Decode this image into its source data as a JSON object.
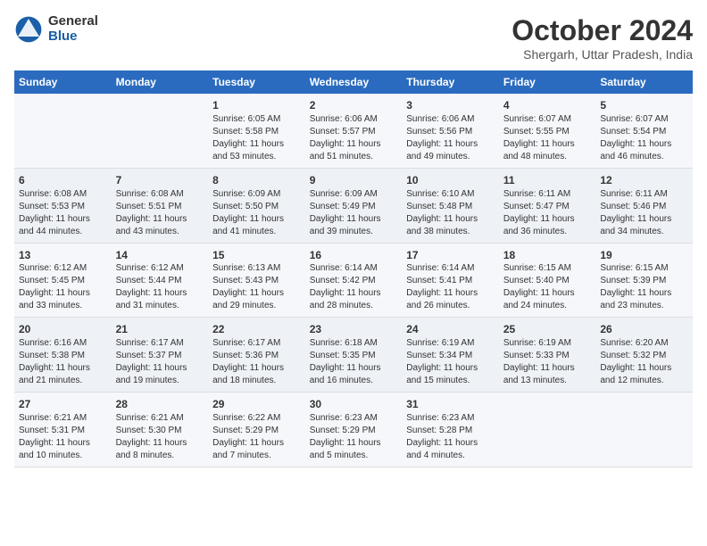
{
  "logo": {
    "general": "General",
    "blue": "Blue"
  },
  "title": "October 2024",
  "subtitle": "Shergarh, Uttar Pradesh, India",
  "days_of_week": [
    "Sunday",
    "Monday",
    "Tuesday",
    "Wednesday",
    "Thursday",
    "Friday",
    "Saturday"
  ],
  "weeks": [
    [
      {
        "day": "",
        "sunrise": "",
        "sunset": "",
        "daylight": ""
      },
      {
        "day": "",
        "sunrise": "",
        "sunset": "",
        "daylight": ""
      },
      {
        "day": "1",
        "sunrise": "Sunrise: 6:05 AM",
        "sunset": "Sunset: 5:58 PM",
        "daylight": "Daylight: 11 hours and 53 minutes."
      },
      {
        "day": "2",
        "sunrise": "Sunrise: 6:06 AM",
        "sunset": "Sunset: 5:57 PM",
        "daylight": "Daylight: 11 hours and 51 minutes."
      },
      {
        "day": "3",
        "sunrise": "Sunrise: 6:06 AM",
        "sunset": "Sunset: 5:56 PM",
        "daylight": "Daylight: 11 hours and 49 minutes."
      },
      {
        "day": "4",
        "sunrise": "Sunrise: 6:07 AM",
        "sunset": "Sunset: 5:55 PM",
        "daylight": "Daylight: 11 hours and 48 minutes."
      },
      {
        "day": "5",
        "sunrise": "Sunrise: 6:07 AM",
        "sunset": "Sunset: 5:54 PM",
        "daylight": "Daylight: 11 hours and 46 minutes."
      }
    ],
    [
      {
        "day": "6",
        "sunrise": "Sunrise: 6:08 AM",
        "sunset": "Sunset: 5:53 PM",
        "daylight": "Daylight: 11 hours and 44 minutes."
      },
      {
        "day": "7",
        "sunrise": "Sunrise: 6:08 AM",
        "sunset": "Sunset: 5:51 PM",
        "daylight": "Daylight: 11 hours and 43 minutes."
      },
      {
        "day": "8",
        "sunrise": "Sunrise: 6:09 AM",
        "sunset": "Sunset: 5:50 PM",
        "daylight": "Daylight: 11 hours and 41 minutes."
      },
      {
        "day": "9",
        "sunrise": "Sunrise: 6:09 AM",
        "sunset": "Sunset: 5:49 PM",
        "daylight": "Daylight: 11 hours and 39 minutes."
      },
      {
        "day": "10",
        "sunrise": "Sunrise: 6:10 AM",
        "sunset": "Sunset: 5:48 PM",
        "daylight": "Daylight: 11 hours and 38 minutes."
      },
      {
        "day": "11",
        "sunrise": "Sunrise: 6:11 AM",
        "sunset": "Sunset: 5:47 PM",
        "daylight": "Daylight: 11 hours and 36 minutes."
      },
      {
        "day": "12",
        "sunrise": "Sunrise: 6:11 AM",
        "sunset": "Sunset: 5:46 PM",
        "daylight": "Daylight: 11 hours and 34 minutes."
      }
    ],
    [
      {
        "day": "13",
        "sunrise": "Sunrise: 6:12 AM",
        "sunset": "Sunset: 5:45 PM",
        "daylight": "Daylight: 11 hours and 33 minutes."
      },
      {
        "day": "14",
        "sunrise": "Sunrise: 6:12 AM",
        "sunset": "Sunset: 5:44 PM",
        "daylight": "Daylight: 11 hours and 31 minutes."
      },
      {
        "day": "15",
        "sunrise": "Sunrise: 6:13 AM",
        "sunset": "Sunset: 5:43 PM",
        "daylight": "Daylight: 11 hours and 29 minutes."
      },
      {
        "day": "16",
        "sunrise": "Sunrise: 6:14 AM",
        "sunset": "Sunset: 5:42 PM",
        "daylight": "Daylight: 11 hours and 28 minutes."
      },
      {
        "day": "17",
        "sunrise": "Sunrise: 6:14 AM",
        "sunset": "Sunset: 5:41 PM",
        "daylight": "Daylight: 11 hours and 26 minutes."
      },
      {
        "day": "18",
        "sunrise": "Sunrise: 6:15 AM",
        "sunset": "Sunset: 5:40 PM",
        "daylight": "Daylight: 11 hours and 24 minutes."
      },
      {
        "day": "19",
        "sunrise": "Sunrise: 6:15 AM",
        "sunset": "Sunset: 5:39 PM",
        "daylight": "Daylight: 11 hours and 23 minutes."
      }
    ],
    [
      {
        "day": "20",
        "sunrise": "Sunrise: 6:16 AM",
        "sunset": "Sunset: 5:38 PM",
        "daylight": "Daylight: 11 hours and 21 minutes."
      },
      {
        "day": "21",
        "sunrise": "Sunrise: 6:17 AM",
        "sunset": "Sunset: 5:37 PM",
        "daylight": "Daylight: 11 hours and 19 minutes."
      },
      {
        "day": "22",
        "sunrise": "Sunrise: 6:17 AM",
        "sunset": "Sunset: 5:36 PM",
        "daylight": "Daylight: 11 hours and 18 minutes."
      },
      {
        "day": "23",
        "sunrise": "Sunrise: 6:18 AM",
        "sunset": "Sunset: 5:35 PM",
        "daylight": "Daylight: 11 hours and 16 minutes."
      },
      {
        "day": "24",
        "sunrise": "Sunrise: 6:19 AM",
        "sunset": "Sunset: 5:34 PM",
        "daylight": "Daylight: 11 hours and 15 minutes."
      },
      {
        "day": "25",
        "sunrise": "Sunrise: 6:19 AM",
        "sunset": "Sunset: 5:33 PM",
        "daylight": "Daylight: 11 hours and 13 minutes."
      },
      {
        "day": "26",
        "sunrise": "Sunrise: 6:20 AM",
        "sunset": "Sunset: 5:32 PM",
        "daylight": "Daylight: 11 hours and 12 minutes."
      }
    ],
    [
      {
        "day": "27",
        "sunrise": "Sunrise: 6:21 AM",
        "sunset": "Sunset: 5:31 PM",
        "daylight": "Daylight: 11 hours and 10 minutes."
      },
      {
        "day": "28",
        "sunrise": "Sunrise: 6:21 AM",
        "sunset": "Sunset: 5:30 PM",
        "daylight": "Daylight: 11 hours and 8 minutes."
      },
      {
        "day": "29",
        "sunrise": "Sunrise: 6:22 AM",
        "sunset": "Sunset: 5:29 PM",
        "daylight": "Daylight: 11 hours and 7 minutes."
      },
      {
        "day": "30",
        "sunrise": "Sunrise: 6:23 AM",
        "sunset": "Sunset: 5:29 PM",
        "daylight": "Daylight: 11 hours and 5 minutes."
      },
      {
        "day": "31",
        "sunrise": "Sunrise: 6:23 AM",
        "sunset": "Sunset: 5:28 PM",
        "daylight": "Daylight: 11 hours and 4 minutes."
      },
      {
        "day": "",
        "sunrise": "",
        "sunset": "",
        "daylight": ""
      },
      {
        "day": "",
        "sunrise": "",
        "sunset": "",
        "daylight": ""
      }
    ]
  ]
}
